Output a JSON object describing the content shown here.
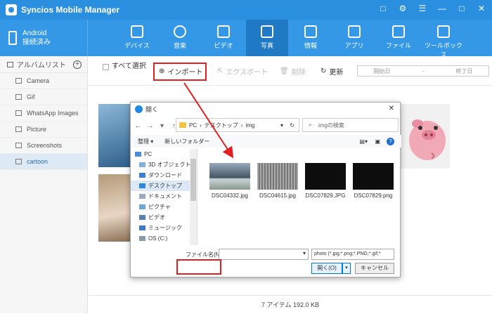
{
  "app": {
    "title": "Syncios Mobile Manager"
  },
  "window_controls": [
    "□",
    "⚙",
    "☰",
    "—",
    "□",
    "✕"
  ],
  "device": {
    "name": "Android",
    "status": "接続済み"
  },
  "nav_tabs": [
    {
      "label": "デバイス",
      "icon": "home-icon"
    },
    {
      "label": "音楽",
      "icon": "music-icon"
    },
    {
      "label": "ビデオ",
      "icon": "video-icon"
    },
    {
      "label": "写真",
      "icon": "photo-icon"
    },
    {
      "label": "情報",
      "icon": "contacts-icon"
    },
    {
      "label": "アプリ",
      "icon": "apps-icon"
    },
    {
      "label": "ファイル",
      "icon": "folder-icon"
    },
    {
      "label": "ツールボックス",
      "icon": "toolbox-icon"
    }
  ],
  "active_tab": "写真",
  "sidebar": {
    "header": "アルバムリスト",
    "albums": [
      "Camera",
      "Gif",
      "WhatsApp Images",
      "Picture",
      "Screenshots",
      "cartoon"
    ],
    "selected": "cartoon"
  },
  "toolbar": {
    "select_all": "すべて選択",
    "import": "インポート",
    "export": "エクスポート",
    "delete": "削除",
    "refresh": "更新",
    "start_date": "開始日",
    "date_sep": "-",
    "end_date": "終了日"
  },
  "status": {
    "text": "7 アイテム 192.0 KB"
  },
  "dialog": {
    "title": "開く",
    "close": "✕",
    "path": [
      "PC",
      "デスクトップ",
      "img"
    ],
    "search_placeholder": "imgの検索",
    "organize": "整理 ▾",
    "new_folder": "新しいフォルダー",
    "tree": [
      "PC",
      "3D オブジェクト",
      "ダウンロード",
      "デスクトップ",
      "ドキュメント",
      "ピクチャ",
      "ビデオ",
      "ミュージック",
      "OS (C:)"
    ],
    "tree_selected": "デスクトップ",
    "files": [
      "DSC04332.jpg",
      "DSC04615.jpg",
      "DSC07829.JPG",
      "DSC07829.png"
    ],
    "filename_label": "ファイル名(N):",
    "filetype": "photo (*.jpg;*.png;*.PNG;*.gif;*",
    "open_button": "開く(O)",
    "cancel_button": "キャンセル"
  },
  "colors": {
    "accent": "#2b8fe0",
    "highlight": "#e02020"
  }
}
